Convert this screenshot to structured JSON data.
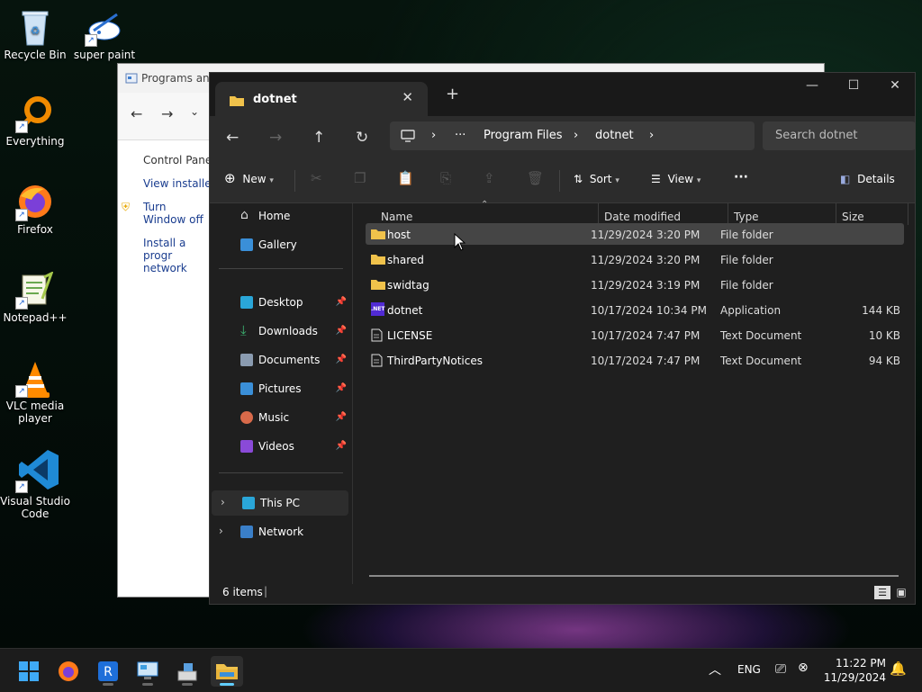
{
  "desktop": {
    "icons": [
      {
        "label": "Recycle Bin"
      },
      {
        "label": "super paint"
      },
      {
        "label": "Everything"
      },
      {
        "label": "Firefox"
      },
      {
        "label": "Notepad++"
      },
      {
        "label": "VLC media player"
      },
      {
        "label": "Visual Studio Code"
      }
    ]
  },
  "background_window": {
    "title": "Programs and",
    "links": [
      "Control Panel",
      "View installed",
      "Turn Window off",
      "Install a progr network"
    ]
  },
  "explorer": {
    "tab_title": "dotnet",
    "breadcrumb": [
      "Program Files",
      "dotnet"
    ],
    "more_crumbs": "···",
    "search_placeholder": "Search dotnet",
    "toolbar": {
      "new": "New",
      "sort": "Sort",
      "view": "View",
      "more": "···",
      "details": "Details"
    },
    "sidebar": {
      "home": "Home",
      "gallery": "Gallery",
      "quick": [
        "Desktop",
        "Downloads",
        "Documents",
        "Pictures",
        "Music",
        "Videos"
      ],
      "this_pc": "This PC",
      "network": "Network"
    },
    "columns": {
      "name": "Name",
      "date": "Date modified",
      "type": "Type",
      "size": "Size"
    },
    "files": [
      {
        "name": "host",
        "date": "11/29/2024 3:20 PM",
        "type": "File folder",
        "size": "",
        "icon": "folder-icon"
      },
      {
        "name": "shared",
        "date": "11/29/2024 3:20 PM",
        "type": "File folder",
        "size": "",
        "icon": "folder-icon"
      },
      {
        "name": "swidtag",
        "date": "11/29/2024 3:19 PM",
        "type": "File folder",
        "size": "",
        "icon": "folder-icon"
      },
      {
        "name": "dotnet",
        "date": "10/17/2024 10:34 PM",
        "type": "Application",
        "size": "144 KB",
        "icon": "dotnet-app-icon"
      },
      {
        "name": "LICENSE",
        "date": "10/17/2024 7:47 PM",
        "type": "Text Document",
        "size": "10 KB",
        "icon": "text-file-icon"
      },
      {
        "name": "ThirdPartyNotices",
        "date": "10/17/2024 7:47 PM",
        "type": "Text Document",
        "size": "94 KB",
        "icon": "text-file-icon"
      }
    ],
    "net_badge": ".NET",
    "status": "6 items"
  },
  "taskbar": {
    "lang": "ENG",
    "time": "11:22 PM",
    "date": "11/29/2024"
  },
  "colors": {
    "accent": "#60cdff",
    "folder": "#f0c24b",
    "hover_row": "#454545"
  }
}
